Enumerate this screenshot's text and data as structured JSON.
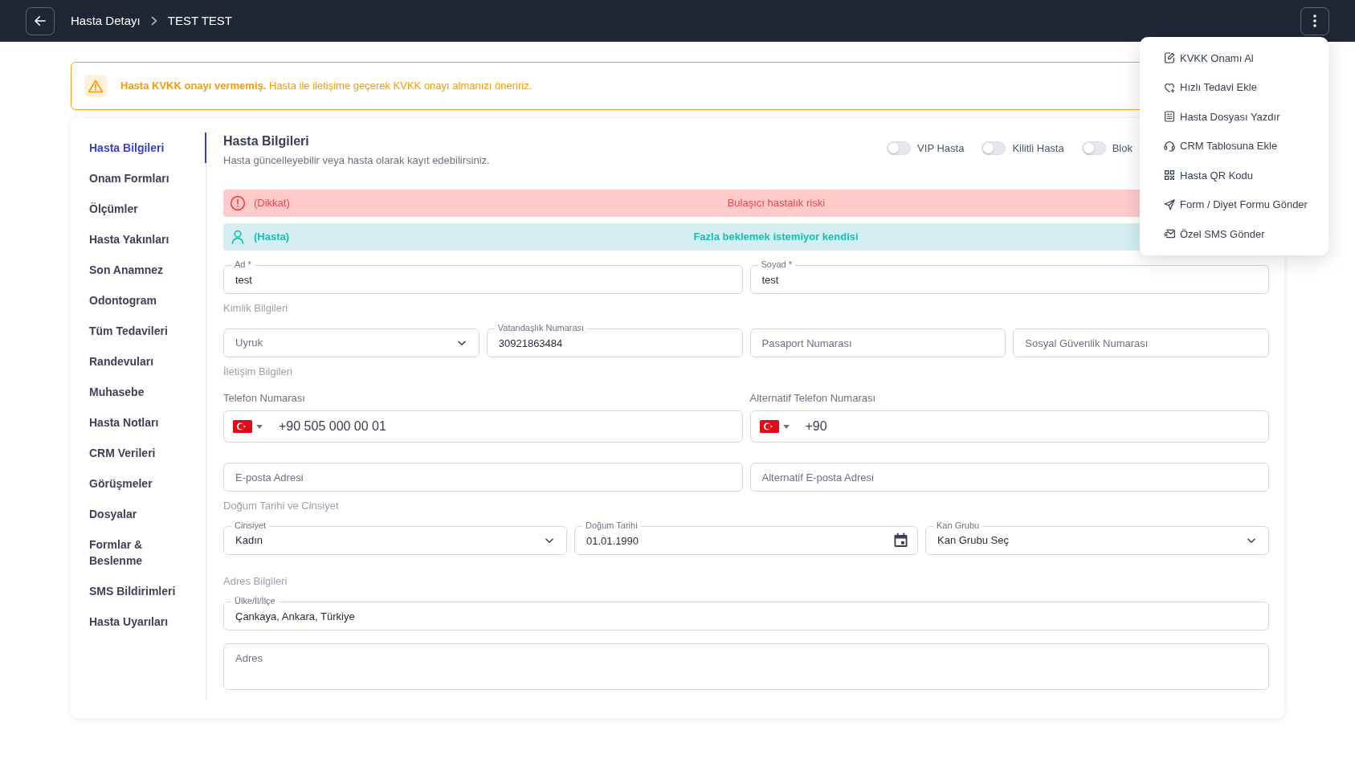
{
  "header": {
    "breadcrumb": [
      "Hasta Detayı",
      "TEST TEST"
    ]
  },
  "actions_menu": {
    "expanded": true,
    "items": [
      "KVKK Onamı Al",
      "Hızlı Tedavi Ekle",
      "Hasta Dosyası Yazdır",
      "CRM Tablosuna Ekle",
      "Hasta QR Kodu",
      "Form / Diyet Formu Gönder",
      "Özel SMS Gönder"
    ]
  },
  "kvkk_warning": {
    "message": "**Hasta KVKK onayı vermemiş.** Hasta ile iletişime geçerek KVKK onayı almanızı öneririz."
  },
  "sidebar": {
    "items": [
      {
        "label": "Hasta Bilgileri",
        "selected": true
      },
      {
        "label": "Onam Formları",
        "selected": false
      },
      {
        "label": "Ölçümler",
        "selected": false
      },
      {
        "label": "Hasta Yakınları",
        "selected": false
      },
      {
        "label": "Son Anamnez",
        "selected": false
      },
      {
        "label": "Odontogram",
        "selected": false
      },
      {
        "label": "Tüm Tedavileri",
        "selected": false
      },
      {
        "label": "Randevuları",
        "selected": false
      },
      {
        "label": "Muhasebe",
        "selected": false
      },
      {
        "label": "Hasta Notları",
        "selected": false
      },
      {
        "label": "CRM Verileri",
        "selected": false
      },
      {
        "label": "Görüşmeler",
        "selected": false
      },
      {
        "label": "Dosyalar",
        "selected": false
      },
      {
        "label": "Formlar & Beslenme",
        "selected": false
      },
      {
        "label": "SMS Bildirimleri",
        "selected": false
      },
      {
        "label": "Hasta Uyarıları",
        "selected": false
      }
    ]
  },
  "panel": {
    "title": "Hasta Bilgileri",
    "subtitle": "Hasta güncelleyebilir veya hasta olarak kayıt edebilirsiniz.",
    "toggles": [
      {
        "label": "VIP Hasta",
        "on": false
      },
      {
        "label": "Kilitli Hasta",
        "on": false
      },
      {
        "label": "Blok",
        "on": false
      }
    ],
    "notices": [
      {
        "kind": "danger",
        "tag": "(Dikkat)",
        "text": "Bulaşıcı hastalık riski"
      },
      {
        "kind": "info",
        "tag": "(Hasta)",
        "text": "Fazla beklemek istemiyor kendisi"
      }
    ],
    "form_rows": [
      {
        "kind": "fields",
        "fields": [
          {
            "kind": "text",
            "label": "Ad *",
            "value": "test"
          },
          {
            "kind": "text",
            "label": "Soyad *",
            "value": "test"
          }
        ]
      },
      {
        "kind": "heading",
        "text": "Kimlik Bilgileri"
      },
      {
        "kind": "fields",
        "fields": [
          {
            "kind": "select",
            "placeholder": "Uyruk"
          },
          {
            "kind": "text",
            "label": "Vatandaşlık Numarası",
            "value": "30921863484"
          },
          {
            "kind": "text",
            "placeholder": "Pasaport Numarası"
          },
          {
            "kind": "text",
            "placeholder": "Sosyal Güvenlik Numarası"
          }
        ]
      },
      {
        "kind": "heading",
        "text": "İletişim Bilgileri"
      },
      {
        "kind": "fields",
        "fields": [
          {
            "kind": "phone",
            "caption": "Telefon Numarası",
            "value": "+90 505 000 00 01"
          },
          {
            "kind": "phone",
            "caption": "Alternatif Telefon Numarası",
            "value": "+90"
          }
        ]
      },
      {
        "kind": "fields",
        "fields": [
          {
            "kind": "text",
            "placeholder": "E-posta Adresi"
          },
          {
            "kind": "text",
            "placeholder": "Alternatif E-posta Adresi"
          }
        ]
      },
      {
        "kind": "heading",
        "text": "Doğum Tarihi ve Cinsiyet"
      },
      {
        "kind": "fields",
        "fields": [
          {
            "kind": "select",
            "label": "Cinsiyet",
            "value": "Kadın"
          },
          {
            "kind": "date",
            "label": "Doğum Tarihi",
            "value": "01.01.1990"
          },
          {
            "kind": "select",
            "label": "Kan Grubu",
            "value": "Kan Grubu Seç"
          }
        ]
      },
      {
        "kind": "heading",
        "text": "Adres Bilgileri"
      },
      {
        "kind": "fields",
        "fields": [
          {
            "kind": "text",
            "label": "Ülke/İl/İlçe",
            "value": "Çankaya, Ankara, Türkiye"
          }
        ]
      },
      {
        "kind": "fields",
        "fields": [
          {
            "kind": "textarea",
            "placeholder": "Adres"
          }
        ]
      }
    ]
  }
}
